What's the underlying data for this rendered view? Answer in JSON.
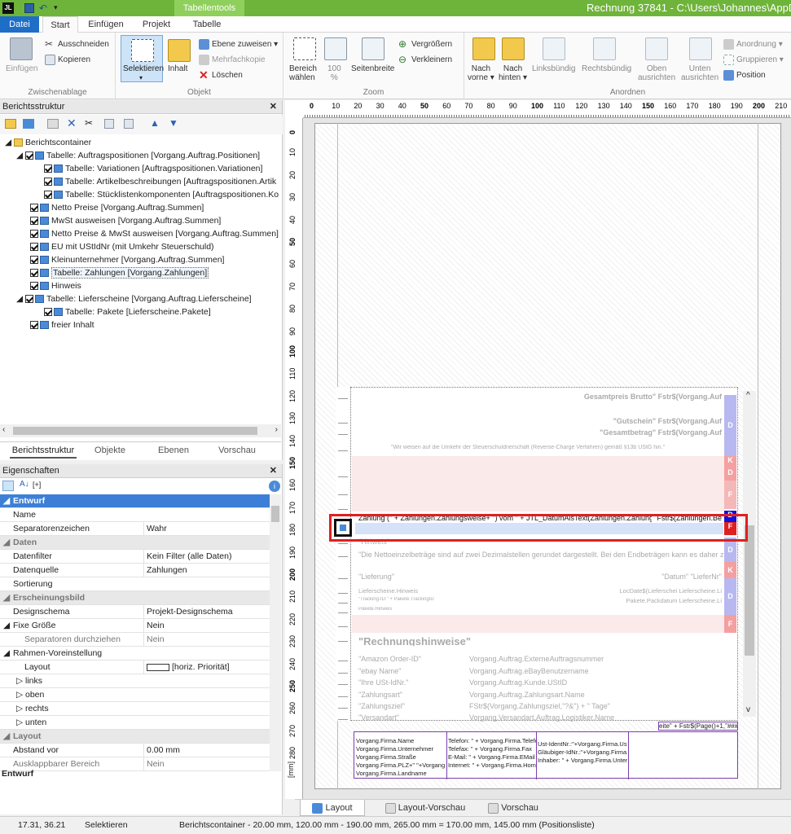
{
  "window": {
    "title": "Rechnung 37841 - C:\\Users\\Johannes\\AppD",
    "context_tab_group": "Tabellentools"
  },
  "tabs": [
    "Datei",
    "Start",
    "Einfügen",
    "Projekt",
    "Tabelle"
  ],
  "ribbon": {
    "zwischenablage": {
      "label": "Zwischenablage",
      "einfuegen": "Einfügen",
      "ausschneiden": "Ausschneiden",
      "kopieren": "Kopieren"
    },
    "objekt": {
      "label": "Objekt",
      "selektieren": "Selektieren",
      "inhalt": "Inhalt",
      "ebene_zuweisen": "Ebene zuweisen",
      "mehrfachkopie": "Mehrfachkopie",
      "loeschen": "Löschen"
    },
    "zoom": {
      "label": "Zoom",
      "bereich_waehlen_1": "Bereich",
      "bereich_waehlen_2": "wählen",
      "hundert_1": "100",
      "hundert_2": "%",
      "seitenbreite": "Seitenbreite",
      "vergroessern": "Vergrößern",
      "verkleinern": "Verkleinern"
    },
    "anordnen": {
      "label": "Anordnen",
      "nach_vorne_1": "Nach",
      "nach_vorne_2": "vorne",
      "nach_hinten_1": "Nach",
      "nach_hinten_2": "hinten",
      "linksbuendig": "Linksbündig",
      "rechtsbuendig": "Rechtsbündig",
      "oben_1": "Oben",
      "oben_2": "ausrichten",
      "unten_1": "Unten",
      "unten_2": "ausrichten",
      "anordnung": "Anordnung",
      "gruppieren": "Gruppieren",
      "position": "Position"
    }
  },
  "berichtsstruktur": {
    "title": "Berichtsstruktur",
    "items": [
      {
        "label": "Berichtscontainer",
        "level": 0
      },
      {
        "label": "Tabelle: Auftragspositionen [Vorgang.Auftrag.Positionen]",
        "level": 1
      },
      {
        "label": "Tabelle: Variationen [Auftragspositionen.Variationen]",
        "level": 2
      },
      {
        "label": "Tabelle: Artikelbeschreibungen [Auftragspositionen.Artik",
        "level": 2
      },
      {
        "label": "Tabelle: Stücklistenkomponenten [Auftragspositionen.Ko",
        "level": 2
      },
      {
        "label": "Netto Preise [Vorgang.Auftrag.Summen]",
        "level": 1
      },
      {
        "label": "MwSt ausweisen [Vorgang.Auftrag.Summen]",
        "level": 1
      },
      {
        "label": "Netto Preise & MwSt ausweisen [Vorgang.Auftrag.Summen]",
        "level": 1
      },
      {
        "label": "EU mit UStIdNr (mit Umkehr Steuerschuld)",
        "level": 1
      },
      {
        "label": "Kleinunternehmer [Vorgang.Auftrag.Summen]",
        "level": 1
      },
      {
        "label": "Tabelle: Zahlungen [Vorgang.Zahlungen]",
        "level": 1
      },
      {
        "label": "Hinweis",
        "level": 1
      },
      {
        "label": "Tabelle: Lieferscheine [Vorgang.Auftrag.Lieferscheine]",
        "level": 1
      },
      {
        "label": "Tabelle: Pakete [Lieferscheine.Pakete]",
        "level": 2
      },
      {
        "label": "freier Inhalt",
        "level": 1
      }
    ],
    "tabs": [
      "Berichtsstruktur",
      "Objekte",
      "Ebenen",
      "Vorschau"
    ]
  },
  "eigenschaften": {
    "title": "Eigenschaften",
    "rows": [
      {
        "type": "cat",
        "key": "Entwurf"
      },
      {
        "type": "prop",
        "key": "Name",
        "value": ""
      },
      {
        "type": "prop",
        "key": "Separatorenzeichen",
        "value": "Wahr"
      },
      {
        "type": "cat",
        "key": "Daten"
      },
      {
        "type": "prop",
        "key": "Datenfilter",
        "value": "Kein Filter (alle Daten)"
      },
      {
        "type": "prop",
        "key": "Datenquelle",
        "value": "Zahlungen"
      },
      {
        "type": "prop",
        "key": "Sortierung",
        "value": ""
      },
      {
        "type": "cat",
        "key": "Erscheinungsbild"
      },
      {
        "type": "prop",
        "key": "Designschema",
        "value": "Projekt-Designschema"
      },
      {
        "type": "prop",
        "key": "Fixe Größe",
        "value": "Nein"
      },
      {
        "type": "prop",
        "key": "Separatoren durchziehen",
        "value": "Nein"
      },
      {
        "type": "prop",
        "key": "Rahmen-Voreinstellung",
        "value": ""
      },
      {
        "type": "prop",
        "key": "Layout",
        "value": "[horiz. Priorität]"
      },
      {
        "type": "prop",
        "key": "links",
        "value": ""
      },
      {
        "type": "prop",
        "key": "oben",
        "value": ""
      },
      {
        "type": "prop",
        "key": "rechts",
        "value": ""
      },
      {
        "type": "prop",
        "key": "unten",
        "value": ""
      },
      {
        "type": "cat",
        "key": "Layout"
      },
      {
        "type": "prop",
        "key": "Abstand vor",
        "value": "0.00 mm"
      },
      {
        "type": "prop",
        "key": "Ausklappbarer Bereich",
        "value": "Nein"
      }
    ],
    "description_title": "Entwurf"
  },
  "ruler": {
    "h_ticks": [
      "0",
      "10",
      "20",
      "30",
      "40",
      "50",
      "60",
      "70",
      "80",
      "90",
      "100",
      "110",
      "120",
      "130",
      "140",
      "150",
      "160",
      "170",
      "180",
      "190",
      "200",
      "210"
    ],
    "v_ticks": [
      "0",
      "10",
      "20",
      "30",
      "40",
      "50",
      "60",
      "70",
      "80",
      "90",
      "100",
      "110",
      "120",
      "130",
      "140",
      "150",
      "160",
      "170",
      "180",
      "190",
      "200",
      "210",
      "220",
      "230",
      "240",
      "250",
      "260",
      "270",
      "280"
    ],
    "unit": "[mm]"
  },
  "report": {
    "rows": [
      {
        "left": "",
        "right": "Gesamtpreis Brutto\"  Fstr$(Vorgang.Auf"
      },
      {
        "left": "",
        "right": "\"Gutschein\"  Fstr$(Vorgang.Auf"
      },
      {
        "left": "",
        "right": "\"Gesamtbetrag\"  Fstr$(Vorgang.Auf"
      },
      {
        "left": "\"Wir weisen auf die Umkehr der Steuerschuldnerschaft (Reverse-Charge Verfahren) gemäß §13b UStG hin.\"",
        "right": ""
      },
      {
        "left": "",
        "right": "\" \"  \" \""
      },
      {
        "left": "",
        "right": "\"Gutschein\"  Fstr$(Vorgang.Auf"
      },
      {
        "left": "",
        "right": "\"Gesamtpreis\"  Fstr$((Vorgang.Auf"
      },
      {
        "left": "Zahlung (\" + Zahlungen.Zahlungsweise+ \") vom \" + JTL_DatumAlsText(Zahlungen.Zahlungsd",
        "right": "Fstr$(Zahlungen.Be"
      },
      {
        "left": "",
        "right": "'offener Betrag'  Fstr$(Vorgang.Auf"
      },
      {
        "left": "\"Hinweis\"",
        "right": ""
      },
      {
        "left": "\"Die Nettoeinzelbeträge sind auf zwei Dezimalstellen gerundet dargestellt. Bei den Endbeträgen kann es daher zu Ab",
        "right": ""
      },
      {
        "left": "\"Lieferung\"",
        "right": "\"Datum\"   \"LieferNr\""
      },
      {
        "left": "Lieferscheine.Hinweis",
        "right": "LocDate$(Lieferschei  Lieferscheine.Li"
      },
      {
        "left": "\"Tracking-ID:\" + Pakete.TrackingID",
        "right": "Pakete.Packdatum  Lieferscheine.Li"
      },
      {
        "left": "Pakete.Hinweis",
        "right": ""
      },
      {
        "left": "\" \"",
        "right": "\" \""
      },
      {
        "left": "\"Rechnungshinweise\"",
        "right": ""
      },
      {
        "left": "\"Amazon Order-ID\"",
        "right": "Vorgang.Auftrag.ExterneAuftragsnummer"
      },
      {
        "left": "\"ebay Name\"",
        "right": "Vorgang.Auftrag.eBayBenutzername"
      },
      {
        "left": "\"Ihre USt-IdNr.\"",
        "right": "Vorgang.Auftrag.Kunde.UStID"
      },
      {
        "left": "\"Zahlungsart\"",
        "right": "Vorgang.Auftrag.Zahlungsart.Name"
      },
      {
        "left": "\"Zahlungsziel\"",
        "right": "FStr$(Vorgang.Zahlungsziel,\"?&\") + \" Tage\""
      },
      {
        "left": "\"Versandart\"",
        "right": "Vorgang.Versandart.Auftrag.Logistiker.Name"
      }
    ],
    "page_number_field": "eite\" + Fstr$(Page()+1,\"###\")",
    "footer_cols": [
      [
        "Vorgang.Firma.Name",
        "Vorgang.Firma.Unternehmer",
        "Vorgang.Firma.Straße",
        "Vorgang.Firma.PLZ+\" \"+Vorgang.F",
        "Vorgang.Firma.Landname"
      ],
      [
        "Telefon: \" + Vorgang.Firma.Telefo",
        "Telefax: \" + Vorgang.Firma.Fax",
        "E-Mail: \" + Vorgang.Firma.EMail",
        "Internet: \" + Vorgang.Firma.Homep"
      ],
      [
        "Ust-IdentNr.:\"+Vorgang.Firma.Ust",
        "Gläubiger-IdNr.:\"+Vorgang.Firma.",
        "Inhaber: \" + Vorgang.Firma.Unterne"
      ],
      []
    ],
    "side_letters": [
      "D",
      "K",
      "D",
      "F",
      "D",
      "F",
      "D",
      "K",
      "D",
      "F"
    ]
  },
  "bottom_tabs": [
    "Layout",
    "Layout-Vorschau",
    "Vorschau"
  ],
  "status": {
    "coords": "17.31, 36.21",
    "mode": "Selektieren",
    "info": "Berichtscontainer  -  20.00 mm, 120.00 mm  -  190.00 mm, 265.00 mm  =  170.00 mm, 145.00 mm (Positionsliste)"
  },
  "colors": {
    "accent": "#6fb43a",
    "tab_blue": "#1e6ec8",
    "selection": "#cce4f7",
    "highlight_red": "#e02020"
  }
}
